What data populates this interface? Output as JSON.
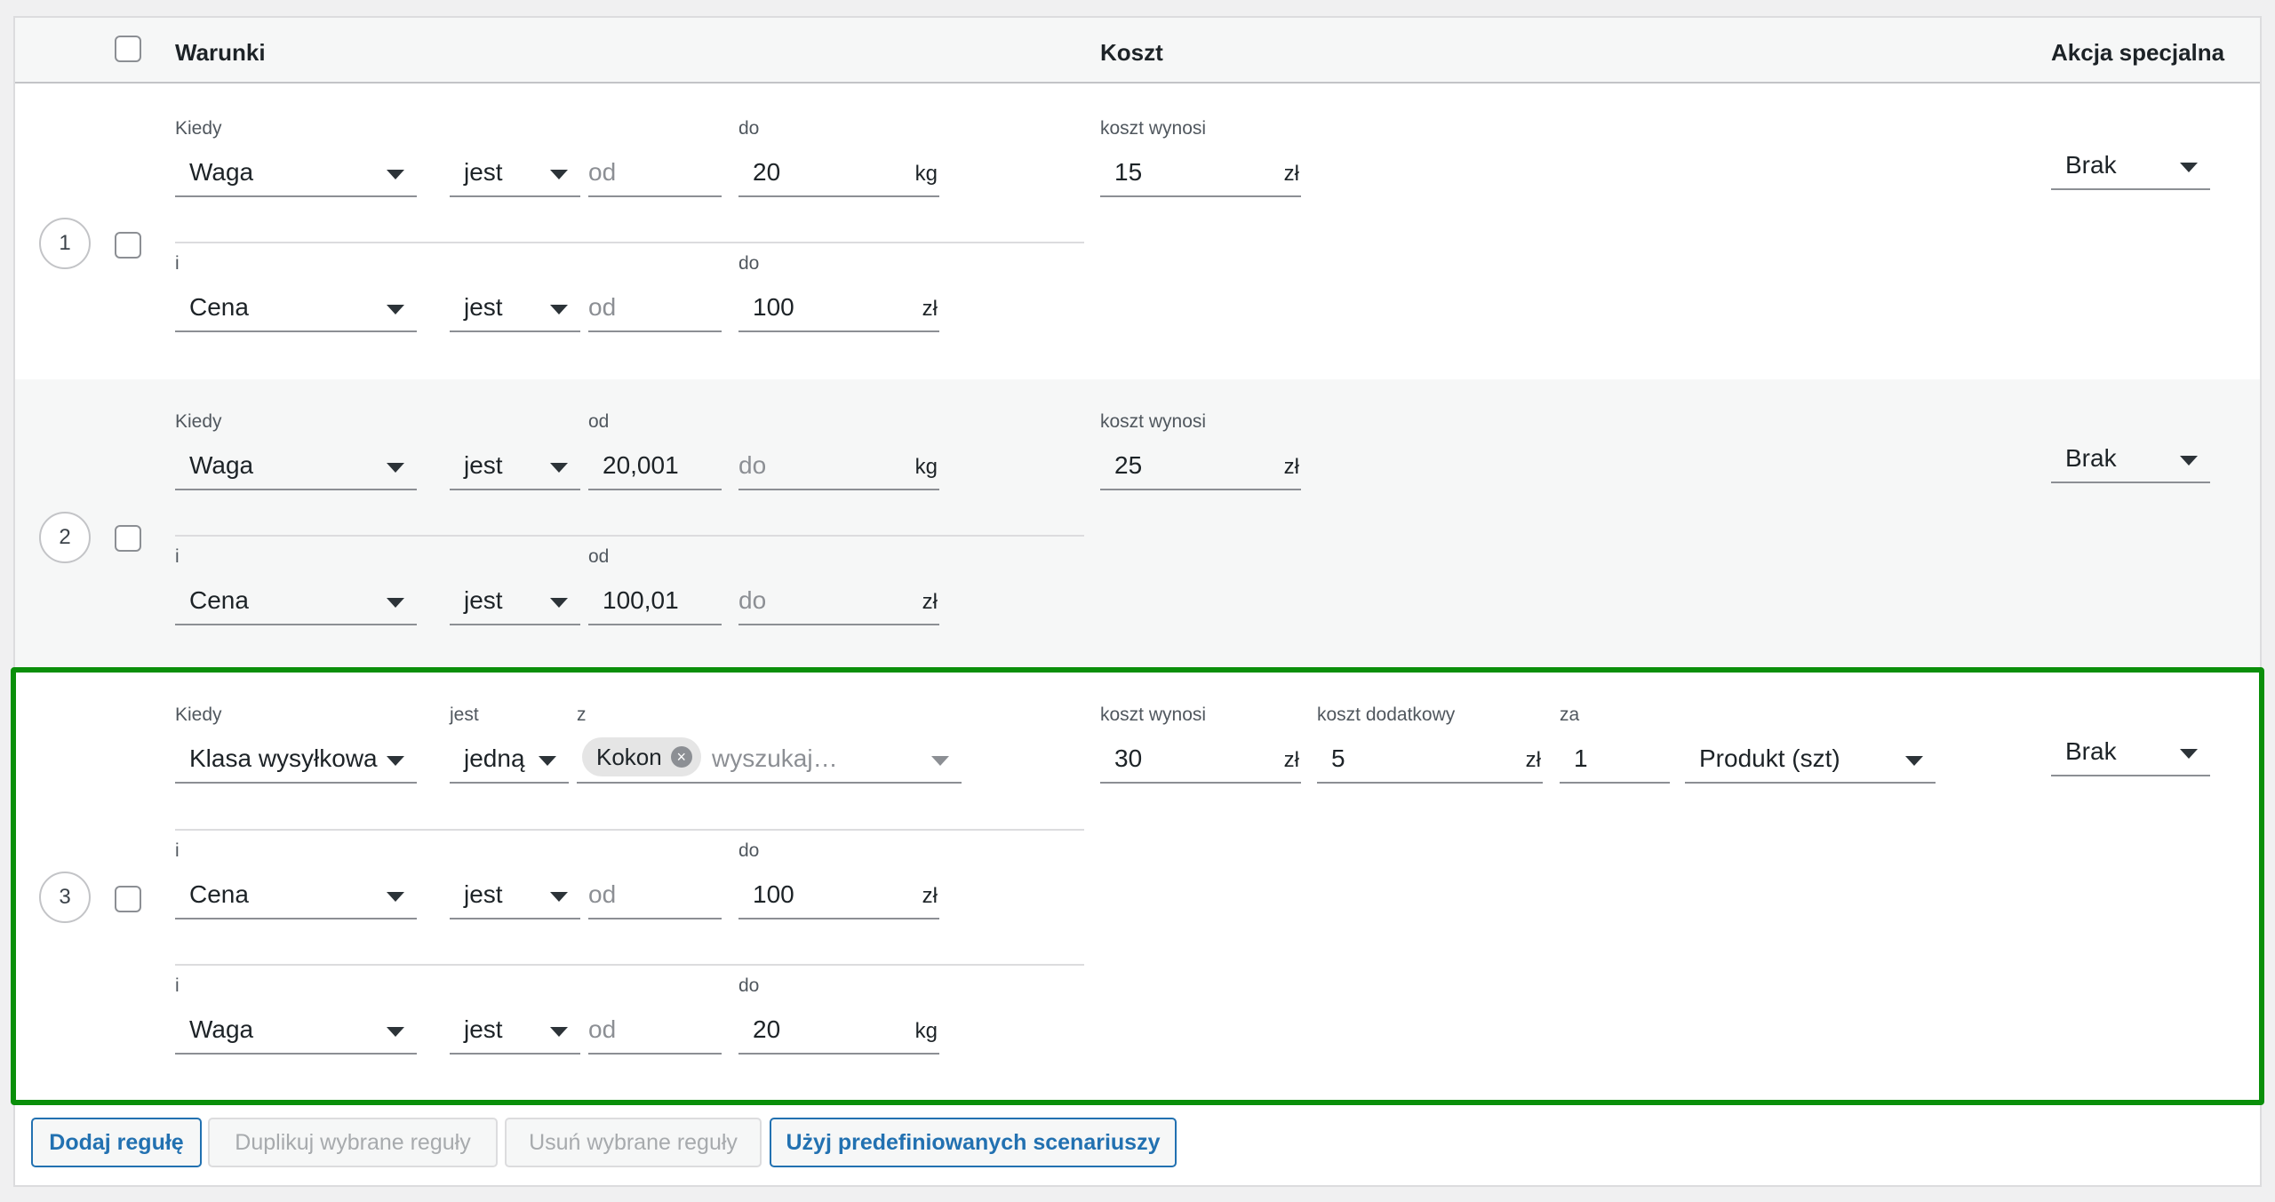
{
  "header": {
    "conditions": "Warunki",
    "cost": "Koszt",
    "special_action": "Akcja specjalna"
  },
  "rows": [
    {
      "number": "1",
      "conditions": [
        {
          "label": "Kiedy",
          "field": "Waga",
          "operator": "jest",
          "from_label": "",
          "from_value": "",
          "from_placeholder": "od",
          "to_label": "do",
          "to_value": "20",
          "to_placeholder": "",
          "unit": "kg"
        },
        {
          "label": "i",
          "field": "Cena",
          "operator": "jest",
          "from_label": "",
          "from_value": "",
          "from_placeholder": "od",
          "to_label": "do",
          "to_value": "100",
          "to_placeholder": "",
          "unit": "zł"
        }
      ],
      "cost_label": "koszt wynosi",
      "cost_value": "15",
      "cost_unit": "zł",
      "special_action": "Brak"
    },
    {
      "number": "2",
      "conditions": [
        {
          "label": "Kiedy",
          "field": "Waga",
          "operator": "jest",
          "from_label": "od",
          "from_value": "20,001",
          "from_placeholder": "",
          "to_label": "",
          "to_value": "",
          "to_placeholder": "do",
          "unit": "kg"
        },
        {
          "label": "i",
          "field": "Cena",
          "operator": "jest",
          "from_label": "od",
          "from_value": "100,01",
          "from_placeholder": "",
          "to_label": "",
          "to_value": "",
          "to_placeholder": "do",
          "unit": "zł"
        }
      ],
      "cost_label": "koszt wynosi",
      "cost_value": "25",
      "cost_unit": "zł",
      "special_action": "Brak"
    },
    {
      "number": "3",
      "class_condition": {
        "label": "Kiedy",
        "field": "Klasa wysyłkowa",
        "operator_label": "jest",
        "operator": "jedną",
        "values_label": "z",
        "chip": "Kokon",
        "search_placeholder": "wyszukaj…"
      },
      "conditions": [
        {
          "label": "i",
          "field": "Cena",
          "operator": "jest",
          "from_label": "",
          "from_value": "",
          "from_placeholder": "od",
          "to_label": "do",
          "to_value": "100",
          "to_placeholder": "",
          "unit": "zł"
        },
        {
          "label": "i",
          "field": "Waga",
          "operator": "jest",
          "from_label": "",
          "from_value": "",
          "from_placeholder": "od",
          "to_label": "do",
          "to_value": "20",
          "to_placeholder": "",
          "unit": "kg"
        }
      ],
      "cost_label": "koszt wynosi",
      "cost_value": "30",
      "cost_unit": "zł",
      "extra_cost_label": "koszt dodatkowy",
      "extra_cost_value": "5",
      "extra_cost_unit": "zł",
      "per_label": "za",
      "per_value": "1",
      "per_unit": "Produkt (szt)",
      "special_action": "Brak"
    }
  ],
  "buttons": {
    "add_rule": "Dodaj regułę",
    "duplicate": "Duplikuj wybrane reguły",
    "remove": "Usuń wybrane reguły",
    "predefined": "Użyj predefiniowanych scenariuszy"
  },
  "colors": {
    "highlight_border": "#0a8f0a",
    "primary_button": "#2271b1"
  }
}
